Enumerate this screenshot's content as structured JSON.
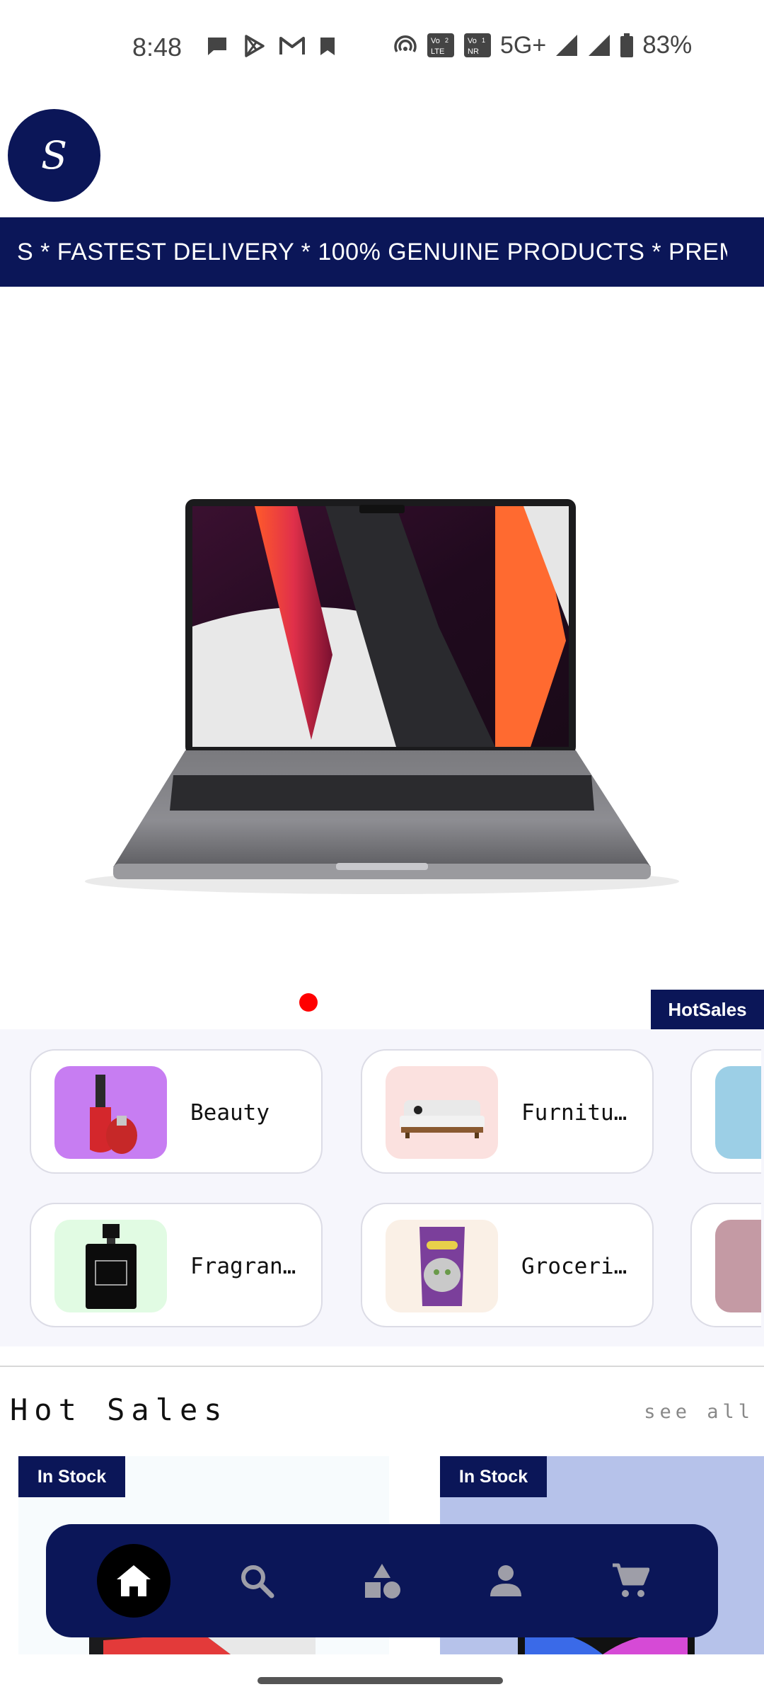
{
  "status_bar": {
    "time": "8:48",
    "network": "5G+",
    "battery": "83%",
    "left_icons": [
      "chat-bubble-icon",
      "play-store-icon",
      "gmail-icon",
      "bookmark-icon"
    ],
    "right_icons": [
      "hotspot-icon",
      "volte-icon",
      "vonr-icon",
      "signal-icon",
      "signal-icon",
      "battery-icon"
    ]
  },
  "logo": {
    "letter": "S"
  },
  "marquee": {
    "text": "S  *   FASTEST DELIVERY  *  100% GENUINE PRODUCTS  *  PREM"
  },
  "hero": {
    "image": "laptop-image",
    "tag": "HotSales"
  },
  "categories": [
    {
      "label": "Beauty",
      "thumb_bg": "#c77df2",
      "icon": "nail-polish-image"
    },
    {
      "label": "Furnitu…",
      "thumb_bg": "#fbe1df",
      "icon": "sofa-image"
    },
    {
      "label": "Fragran…",
      "thumb_bg": "#e1fbe3",
      "icon": "perfume-image"
    },
    {
      "label": "Groceri…",
      "thumb_bg": "#faf0e6",
      "icon": "cat-food-image"
    }
  ],
  "categories_partial_colors": [
    "#9ccfe6",
    "#c49aa4"
  ],
  "hot_sales": {
    "title": "Hot Sales",
    "see_all": "see all",
    "products": [
      {
        "badge": "In Stock",
        "bg": "#f7fbfd"
      },
      {
        "badge": "In Stock",
        "bg": "#b6c2ea"
      }
    ]
  },
  "bottom_nav": {
    "items": [
      "home-icon",
      "search-icon",
      "categories-icon",
      "profile-icon",
      "cart-icon"
    ],
    "active": "home-icon"
  },
  "colors": {
    "brand": "#0b1658",
    "dot": "#ff0000"
  }
}
